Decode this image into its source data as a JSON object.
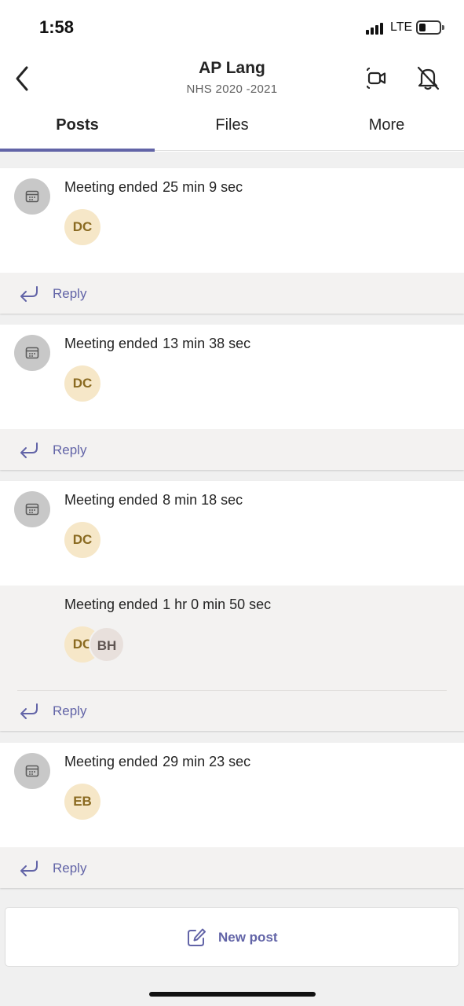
{
  "status_bar": {
    "time": "1:58",
    "network": "LTE"
  },
  "header": {
    "title": "AP Lang",
    "subtitle": "NHS 2020 -2021"
  },
  "tabs": [
    {
      "label": "Posts",
      "active": true
    },
    {
      "label": "Files",
      "active": false
    },
    {
      "label": "More",
      "active": false
    }
  ],
  "posts": [
    {
      "text": "Meeting ended",
      "duration": "25 min 9 sec",
      "participants": [
        "DC"
      ]
    },
    {
      "text": "Meeting ended",
      "duration": "13 min 38 sec",
      "participants": [
        "DC"
      ]
    },
    {
      "text": "Meeting ended",
      "duration": "8 min 18 sec",
      "participants": [
        "DC"
      ],
      "replies": [
        {
          "text": "Meeting ended",
          "duration": "1 hr 0 min 50 sec",
          "participants": [
            "DC",
            "BH"
          ]
        }
      ]
    },
    {
      "text": "Meeting ended",
      "duration": "29 min 23 sec",
      "participants": [
        "EB"
      ]
    }
  ],
  "reply_label": "Reply",
  "new_post_label": "New post",
  "colors": {
    "accent": "#6264a7",
    "avatar_tan": "#f6e7c8",
    "avatar_grey": "#e8e0dc"
  },
  "icons": [
    "back-chevron-icon",
    "meet-now-icon",
    "bell-off-icon",
    "calendar-icon",
    "reply-arrow-icon",
    "compose-icon"
  ]
}
